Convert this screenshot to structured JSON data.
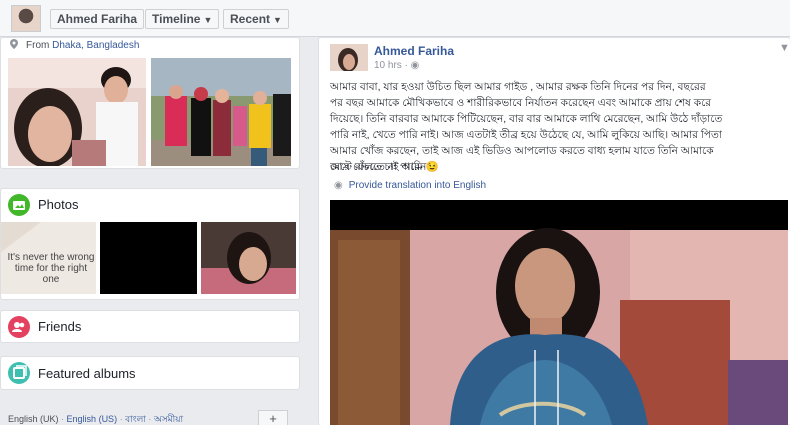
{
  "topbar": {
    "name_label": "Ahmed Fariha",
    "timeline_label": "Timeline",
    "recent_label": "Recent"
  },
  "intro": {
    "from_prefix": "From",
    "from_place": "Dhaka, Bangladesh"
  },
  "photos_section": {
    "title": "Photos",
    "quote_text": "It's never the wrong time for the right one"
  },
  "friends_section": {
    "title": "Friends"
  },
  "albums_section": {
    "title": "Featured albums"
  },
  "languages": {
    "english_uk": "English (UK)",
    "separator": "·",
    "english_us": "English (US)",
    "bangla": "বাংলা",
    "assamese": "অসমীয়া",
    "more_label": "+"
  },
  "post": {
    "author": "Ahmed Fariha",
    "time": "10 hrs",
    "text_lines": [
      "আমার বাবা, যার হওয়া উচিত ছিল আমার গাইড , আমার রক্ষক তিনি দিনের পর দিন, বছরের",
      "পর বছর আমাকে মৌখিকভাবে ও শারীরিকভাবে নির্যাতন করেছেন এবং আমাকে প্রায় শেষ করে",
      "দিয়েছে। তিনি বারবার আমাকে পিটিয়েছেন, বার বার আমাকে লাথি মেরেছেন, আমি উঠে দাঁড়াতে",
      "পারি নাই, খেতে পারি নাই। আজ এতটাই তীব্র হয়ে উঠেছে যে, আমি লুকিয়ে আছি। আমার পিতা",
      "আমার খোঁজ করছেন, তাই আজ এই ভিডিও আপলোড করতে বাধ্য হলাম যাতে তিনি আমাকে",
      "মেরে ফেলতে না পারেন।",
      "জাস্ট বাঁচতে চাই আমি 😉"
    ],
    "translate_label": "Provide translation into English"
  },
  "icons": {
    "pin": "map-pin-icon",
    "photos": "photos-icon",
    "friends": "friends-icon",
    "albums": "albums-icon",
    "globe": "globe-icon",
    "chevron": "chevron-down-icon"
  },
  "colors": {
    "link": "#365899",
    "photos_icon": "#42b72a",
    "friends_icon": "#e4405f",
    "albums_icon": "#3fbfb0"
  }
}
